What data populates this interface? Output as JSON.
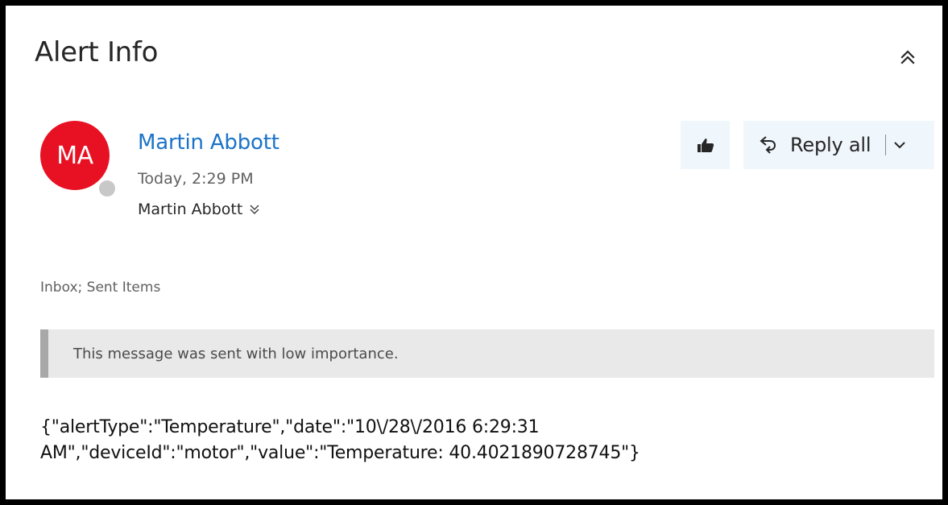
{
  "message": {
    "subject": "Alert Info",
    "sender": {
      "initials": "MA",
      "name": "Martin Abbott",
      "time": "Today, 2:29 PM",
      "avatar_color": "#e81123"
    },
    "recipient": "Martin Abbott",
    "folders": "Inbox; Sent Items",
    "importance_notice": "This message was sent with low importance.",
    "body_lines": [
      "{\"alertType\":\"Temperature\",\"date\":\"10\\/28\\/2016 6:29:31",
      "AM\",\"deviceId\":\"motor\",\"value\":\"Temperature: 40.4021890728745\"}"
    ]
  },
  "actions": {
    "like_icon": "thumbs-up-icon",
    "reply_all_label": "Reply all",
    "reply_all_icon": "reply-all-icon",
    "dropdown_icon": "chevron-down-icon",
    "collapse_icon": "double-chevron-up-icon"
  },
  "colors": {
    "link_blue": "#1a73c8",
    "button_bg": "#eff6fc",
    "notice_bg": "#e9e9e9"
  }
}
